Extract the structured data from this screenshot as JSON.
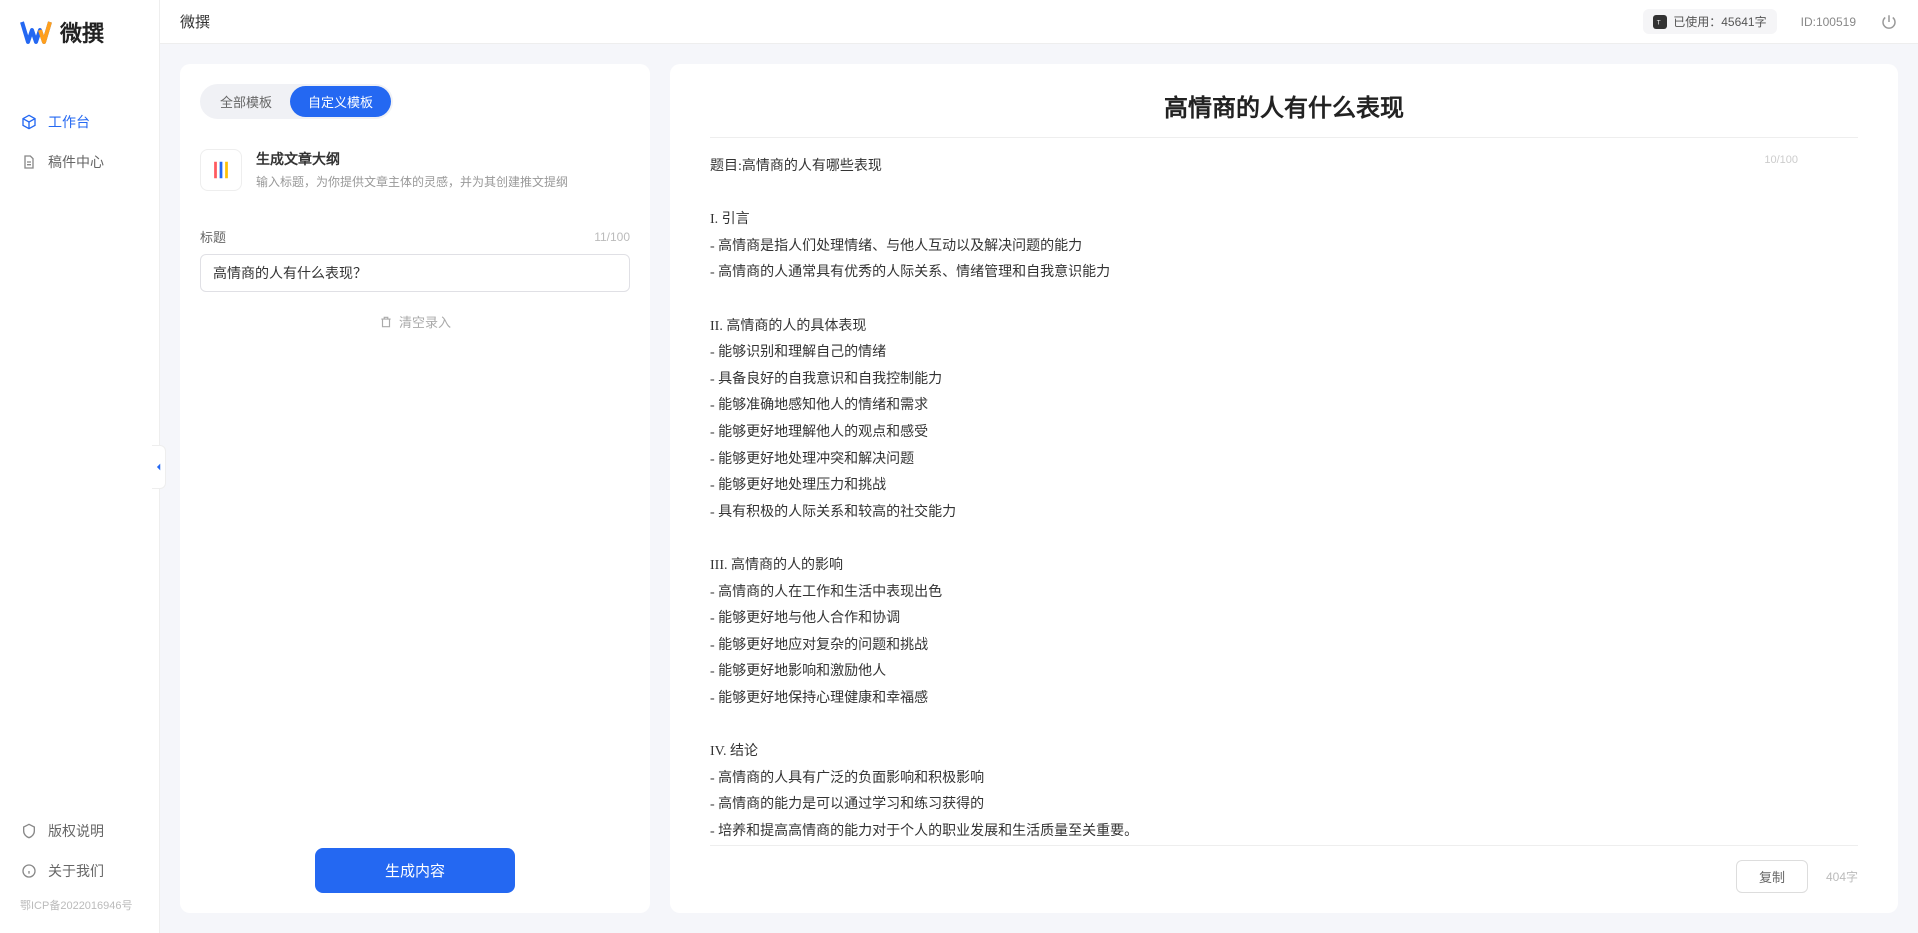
{
  "app": {
    "name": "微撰"
  },
  "sidebar": {
    "nav": [
      {
        "label": "工作台"
      },
      {
        "label": "稿件中心"
      }
    ],
    "footer": [
      {
        "label": "版权说明"
      },
      {
        "label": "关于我们"
      }
    ],
    "icp": "鄂ICP备2022016946号"
  },
  "topbar": {
    "title": "微撰",
    "usage_prefix": "已使用：",
    "usage_value": "45641字",
    "id_label": "ID:100519"
  },
  "tabs": {
    "all": "全部模板",
    "custom": "自定义模板"
  },
  "template": {
    "title": "生成文章大纲",
    "desc": "输入标题，为你提供文章主体的灵感，并为其创建推文提纲"
  },
  "form": {
    "label_title": "标题",
    "title_count": "11/100",
    "title_value": "高情商的人有什么表现？",
    "clear_label": "清空录入",
    "generate_label": "生成内容"
  },
  "output": {
    "title": "高情商的人有什么表现",
    "title_count": "10/100",
    "body": "题目:高情商的人有哪些表现\n\nI. 引言\n- 高情商是指人们处理情绪、与他人互动以及解决问题的能力\n- 高情商的人通常具有优秀的人际关系、情绪管理和自我意识能力\n\nII. 高情商的人的具体表现\n- 能够识别和理解自己的情绪\n- 具备良好的自我意识和自我控制能力\n- 能够准确地感知他人的情绪和需求\n- 能够更好地理解他人的观点和感受\n- 能够更好地处理冲突和解决问题\n- 能够更好地处理压力和挑战\n- 具有积极的人际关系和较高的社交能力\n\nIII. 高情商的人的影响\n- 高情商的人在工作和生活中表现出色\n- 能够更好地与他人合作和协调\n- 能够更好地应对复杂的问题和挑战\n- 能够更好地影响和激励他人\n- 能够更好地保持心理健康和幸福感\n\nIV. 结论\n- 高情商的人具有广泛的负面影响和积极影响\n- 高情商的能力是可以通过学习和练习获得的\n- 培养和提高高情商的能力对于个人的职业发展和生活质量至关重要。",
    "copy_label": "复制",
    "word_count": "404字"
  }
}
